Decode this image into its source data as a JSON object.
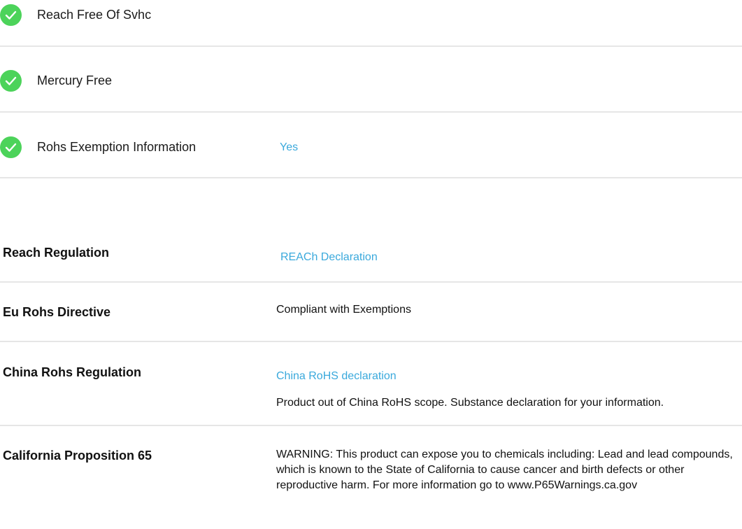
{
  "compliance_checks": [
    {
      "label": "Reach Free Of Svhc",
      "value": "",
      "icon": "check-circle-icon",
      "status_color": "#4cd35a"
    },
    {
      "label": "Mercury Free",
      "value": "",
      "icon": "check-circle-icon",
      "status_color": "#4cd35a"
    },
    {
      "label": "Rohs Exemption Information",
      "value": "Yes",
      "icon": "check-circle-icon",
      "status_color": "#4cd35a"
    }
  ],
  "regulations": {
    "reach": {
      "label": "Reach Regulation",
      "link": "REACh Declaration"
    },
    "eu_rohs": {
      "label": "Eu Rohs Directive",
      "text": "Compliant with Exemptions"
    },
    "china_rohs": {
      "label": "China Rohs Regulation",
      "link": "China RoHS declaration",
      "text": "Product out of China RoHS scope. Substance declaration for your information."
    },
    "prop65": {
      "label": "California Proposition 65",
      "text": "WARNING: This product can expose you to chemicals including: Lead and lead compounds, which is known to the State of California to cause cancer and birth defects or other reproductive harm. For more information go to www.P65Warnings.ca.gov"
    }
  },
  "colors": {
    "link": "#3aa9dc",
    "check": "#4cd35a",
    "divider": "#e6e6e6"
  }
}
